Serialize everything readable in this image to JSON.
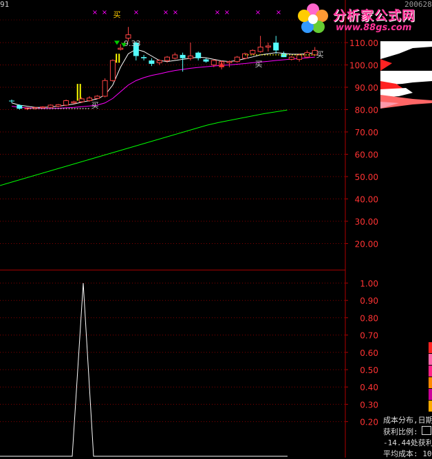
{
  "header": {
    "code_fragment": "91",
    "watermark_brand": "分析家公式网",
    "watermark_url": "www.88gs.com",
    "date_fragment": "200628"
  },
  "chart_data": [
    {
      "type": "candlestick",
      "panel": "price",
      "y_axis_ticks": [
        "110.00",
        "100.00",
        "90.00",
        "80.00",
        "70.00",
        "60.00",
        "50.00",
        "40.00",
        "30.00",
        "20.00"
      ],
      "ylim": [
        13,
        117
      ],
      "candles": [
        {
          "o": 84.0,
          "h": 84.5,
          "l": 83.0,
          "c": 83.8
        },
        {
          "o": 82.0,
          "h": 82.3,
          "l": 80.0,
          "c": 80.4
        },
        {
          "o": 80.4,
          "h": 81.0,
          "l": 79.8,
          "c": 80.7
        },
        {
          "o": 80.5,
          "h": 81.2,
          "l": 80.0,
          "c": 80.9
        },
        {
          "o": 80.8,
          "h": 81.5,
          "l": 80.5,
          "c": 81.2
        },
        {
          "o": 81.0,
          "h": 82.3,
          "l": 80.8,
          "c": 82.0
        },
        {
          "o": 81.5,
          "h": 82.5,
          "l": 81.0,
          "c": 82.2
        },
        {
          "o": 82.0,
          "h": 84.5,
          "l": 81.5,
          "c": 84.0
        },
        {
          "o": 83.0,
          "h": 84.0,
          "l": 82.5,
          "c": 83.5
        },
        {
          "o": 83.5,
          "h": 85.5,
          "l": 83.0,
          "c": 84.8
        },
        {
          "o": 84.0,
          "h": 86.0,
          "l": 83.5,
          "c": 85.2
        },
        {
          "o": 85.0,
          "h": 86.5,
          "l": 84.8,
          "c": 86.0
        },
        {
          "o": 86.0,
          "h": 94.0,
          "l": 85.5,
          "c": 93.0
        },
        {
          "o": 93.0,
          "h": 102.5,
          "l": 92.5,
          "c": 102.0
        },
        {
          "o": 107.0,
          "h": 109.33,
          "l": 106.5,
          "c": 107.5
        },
        {
          "o": 112.0,
          "h": 117.0,
          "l": 110.5,
          "c": 113.5
        },
        {
          "o": 110.0,
          "h": 110.5,
          "l": 102.0,
          "c": 104.0
        },
        {
          "o": 103.5,
          "h": 104.5,
          "l": 102.0,
          "c": 103.0
        },
        {
          "o": 102.0,
          "h": 103.0,
          "l": 99.5,
          "c": 100.5
        },
        {
          "o": 101.0,
          "h": 102.5,
          "l": 100.0,
          "c": 102.0
        },
        {
          "o": 102.0,
          "h": 104.0,
          "l": 101.0,
          "c": 103.5
        },
        {
          "o": 103.0,
          "h": 105.5,
          "l": 102.5,
          "c": 104.5
        },
        {
          "o": 104.5,
          "h": 105.5,
          "l": 97.0,
          "c": 103.0
        },
        {
          "o": 103.0,
          "h": 110.0,
          "l": 102.0,
          "c": 104.0
        },
        {
          "o": 105.5,
          "h": 106.0,
          "l": 102.0,
          "c": 103.0
        },
        {
          "o": 102.5,
          "h": 103.0,
          "l": 101.0,
          "c": 101.5
        },
        {
          "o": 100.0,
          "h": 102.5,
          "l": 99.0,
          "c": 102.0
        },
        {
          "o": 99.5,
          "h": 102.0,
          "l": 98.0,
          "c": 101.5
        },
        {
          "o": 101.0,
          "h": 102.0,
          "l": 99.0,
          "c": 101.5
        },
        {
          "o": 101.5,
          "h": 104.0,
          "l": 101.0,
          "c": 103.5
        },
        {
          "o": 103.0,
          "h": 105.5,
          "l": 102.5,
          "c": 105.0
        },
        {
          "o": 105.0,
          "h": 107.0,
          "l": 104.5,
          "c": 106.5
        },
        {
          "o": 106.0,
          "h": 113.0,
          "l": 105.5,
          "c": 108.0
        },
        {
          "o": 108.0,
          "h": 110.0,
          "l": 106.0,
          "c": 108.5
        },
        {
          "o": 110.0,
          "h": 113.0,
          "l": 105.0,
          "c": 106.5
        },
        {
          "o": 105.0,
          "h": 106.0,
          "l": 103.5,
          "c": 103.5
        },
        {
          "o": 102.5,
          "h": 104.0,
          "l": 102.0,
          "c": 103.5
        },
        {
          "o": 102.5,
          "h": 105.0,
          "l": 101.5,
          "c": 104.5
        },
        {
          "o": 103.5,
          "h": 106.5,
          "l": 103.0,
          "c": 105.5
        },
        {
          "o": 104.5,
          "h": 108.0,
          "l": 104.0,
          "c": 106.5
        }
      ],
      "highlight_bars": [
        {
          "bar": 9,
          "from": 84.0,
          "to": 91.5
        },
        {
          "bar": 14,
          "from": 101.0,
          "to": 105.0
        }
      ],
      "ma_fast": [
        83.0,
        82.0,
        81.5,
        81.0,
        81.0,
        81.2,
        81.5,
        82.0,
        82.5,
        83.3,
        84.0,
        84.8,
        86.5,
        91.0,
        99.0,
        105.0,
        107.0,
        106.0,
        104.0,
        102.0,
        101.5,
        102.0,
        102.5,
        103.0,
        103.5,
        103.2,
        102.5,
        101.8,
        101.5,
        102.0,
        102.8,
        103.6,
        104.5,
        105.0,
        105.5,
        105.2,
        104.8,
        104.8,
        105.0,
        105.5
      ],
      "ma_mid": [
        81.5,
        81.0,
        80.8,
        80.6,
        80.5,
        80.5,
        80.6,
        80.8,
        81.0,
        81.3,
        81.6,
        82.0,
        83.0,
        85.0,
        88.0,
        91.0,
        93.0,
        94.3,
        95.3,
        96.0,
        96.8,
        97.5,
        98.0,
        98.5,
        98.9,
        99.2,
        99.5,
        99.8,
        100.0,
        100.3,
        100.6,
        101.0,
        101.3,
        101.6,
        102.0,
        102.3,
        102.6,
        102.9,
        103.2,
        103.5
      ],
      "ma_slow": [
        46.0,
        47.5,
        49.0,
        50.5,
        52.0,
        53.5,
        55.0,
        56.5,
        58.0,
        59.5,
        61.0,
        62.5,
        64.0,
        65.5,
        67.0,
        68.5,
        70.0,
        71.5,
        73.0,
        74.2,
        75.2,
        76.2,
        77.2,
        78.2,
        79.0,
        79.8
      ],
      "dashed_level": 104.5,
      "price_annotation": "9.33",
      "signal_labels": [
        "买",
        "买",
        "买",
        "买"
      ]
    },
    {
      "type": "line",
      "panel": "indicator",
      "y_axis_ticks": [
        "1.00",
        "0.90",
        "0.80",
        "0.70",
        "0.60",
        "0.50",
        "0.40",
        "0.30",
        "0.20"
      ],
      "ylim": [
        0.0,
        1.06
      ],
      "values": [
        0,
        0,
        0,
        0,
        0,
        0,
        0,
        0,
        0,
        0,
        0,
        0,
        1.0,
        0,
        0,
        0,
        0,
        0,
        0,
        0,
        0,
        0,
        0,
        0,
        0,
        0,
        0,
        0,
        0,
        0,
        0,
        0,
        0,
        0,
        0,
        0,
        0,
        0,
        0,
        0
      ]
    }
  ],
  "cost_panel": {
    "title": "成本分布,日期",
    "profit_label": "获利比例:",
    "profit_line": "-14.44处获利",
    "avg_cost_label": "平均成本: 10"
  },
  "colors": {
    "grid": "#8b0000",
    "axis_text": "#ff3333",
    "up_candle": "#ff4444",
    "down_candle": "#54fcfc",
    "ma_fast": "#ffffff",
    "ma_mid": "#ff00ff",
    "ma_slow": "#00ff00",
    "indicator_line": "#ffffff",
    "signal": "#ffff00",
    "marker_x": "#ff00ff"
  }
}
